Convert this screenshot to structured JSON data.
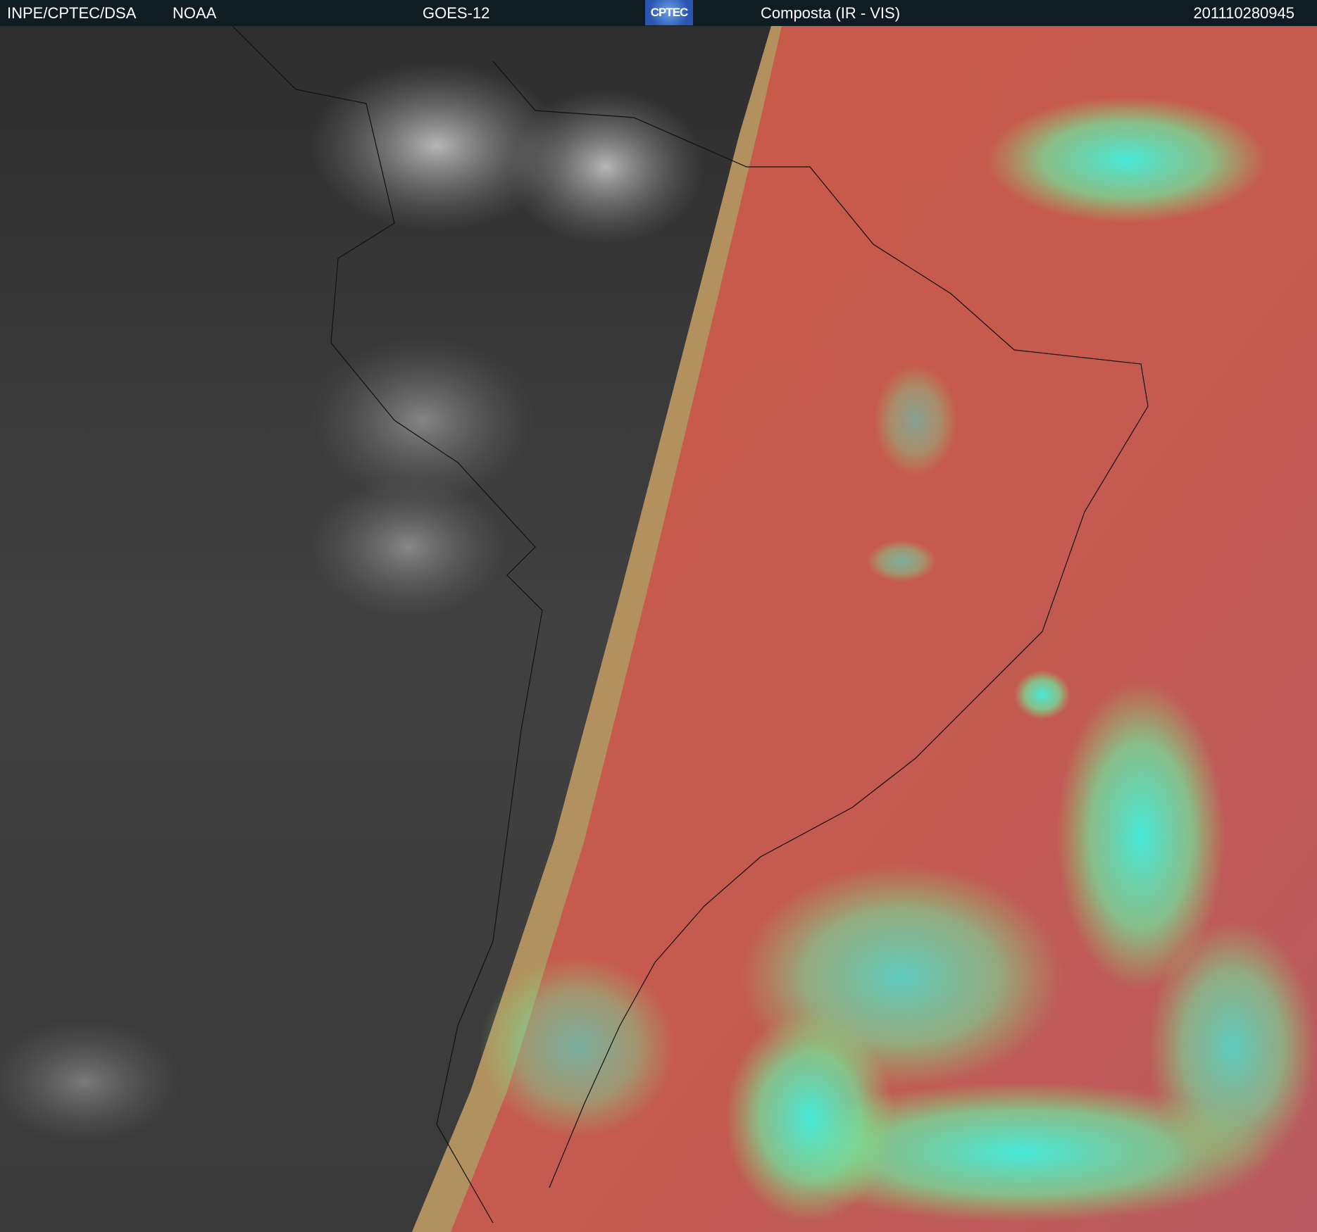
{
  "header": {
    "organization": "INPE/CPTEC/DSA",
    "agency": "NOAA",
    "satellite": "GOES-12",
    "logo_text": "CPTEC",
    "product": "Composta (IR - VIS)",
    "timestamp": "201110280945"
  },
  "colors": {
    "header_bg": "#101c24",
    "night_gray": "#3a3a3a",
    "day_red": "#c0584a",
    "cloud_cyan": "#40f0e0",
    "cloud_green": "#90e070"
  }
}
